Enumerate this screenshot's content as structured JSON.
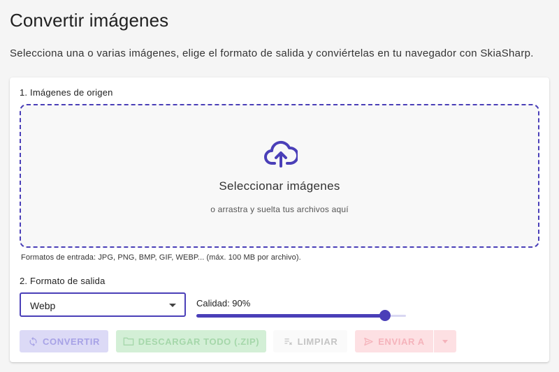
{
  "header": {
    "title": "Convertir imágenes",
    "subtitle": "Selecciona una o varias imágenes, elige el formato de salida y conviértelas en tu navegador con SkiaSharp."
  },
  "source": {
    "section_label": "1. Imágenes de origen",
    "dropzone_title": "Seleccionar imágenes",
    "dropzone_hint": "o arrastra y suelta tus archivos aquí",
    "upload_icon": "cloud-upload-icon",
    "formats_note": "Formatos de entrada: JPG, PNG, BMP, GIF, WEBP... (máx. 100 MB por archivo)."
  },
  "output": {
    "section_label": "2. Formato de salida",
    "format_selected": "Webp",
    "quality_label": "Calidad: 90%",
    "quality_value": 0.9
  },
  "actions": {
    "convert_label": "Convertir",
    "convert_icon": "sync-icon",
    "download_label": "Descargar todo (.zip)",
    "download_icon": "folder-icon",
    "clear_label": "Limpiar",
    "clear_icon": "clear-list-icon",
    "send_label": "Enviar a",
    "send_icon": "send-icon",
    "send_toggle_icon": "caret-down-icon"
  },
  "colors": {
    "primary": "#4a3fb8",
    "convert_disabled_bg": "#dcdaf6",
    "download_disabled_bg": "#d3efd6",
    "send_disabled_bg": "#fde0e3"
  }
}
